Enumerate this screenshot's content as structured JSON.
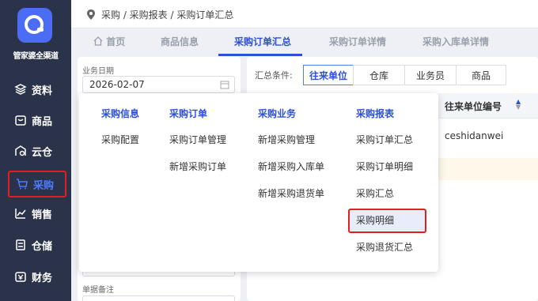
{
  "app": {
    "brand": "管家婆全渠道"
  },
  "sidebar": {
    "items": [
      {
        "label": "资料",
        "icon": "layers-icon",
        "active": false
      },
      {
        "label": "商品",
        "icon": "box-icon",
        "active": false
      },
      {
        "label": "云仓",
        "icon": "cloud-warehouse-icon",
        "active": false
      },
      {
        "label": "采购",
        "icon": "cart-icon",
        "active": true
      },
      {
        "label": "销售",
        "icon": "chart-icon",
        "active": false
      },
      {
        "label": "仓储",
        "icon": "storage-icon",
        "active": false
      },
      {
        "label": "财务",
        "icon": "finance-icon",
        "active": false
      }
    ]
  },
  "breadcrumb": "采购 / 采购报表 / 采购订单汇总",
  "tabs": [
    {
      "label": "首页",
      "icon": "home-icon",
      "active": false
    },
    {
      "label": "商品信息",
      "active": false
    },
    {
      "label": "采购订单汇总",
      "active": true
    },
    {
      "label": "采购订单详情",
      "active": false
    },
    {
      "label": "采购入库单详情",
      "active": false
    }
  ],
  "filters": {
    "business_date_label": "业务日期",
    "business_date_value": "2026-02-07",
    "remark_label": "单据备注"
  },
  "summary": {
    "label": "汇总条件:",
    "options": [
      "往来单位",
      "仓库",
      "业务员",
      "商品"
    ],
    "selected": "往来单位"
  },
  "table": {
    "header": "往来单位编号",
    "row_value": "ceshidanwei"
  },
  "mega_menu": {
    "columns": [
      {
        "title": "采购信息",
        "items": [
          "采购配置"
        ]
      },
      {
        "title": "采购订单",
        "items": [
          "采购订单管理",
          "新增采购订单"
        ]
      },
      {
        "title": "采购业务",
        "items": [
          "新增采购管理",
          "新增采购入库单",
          "新增采购退货单"
        ]
      },
      {
        "title": "采购报表",
        "items": [
          "采购订单汇总",
          "采购订单明细",
          "采购汇总",
          "采购明细",
          "采购退货汇总"
        ]
      }
    ],
    "highlighted_item": "采购明细"
  },
  "colors": {
    "accent": "#2d50d8",
    "sidebar_bg": "#2a3349",
    "highlight_border": "#e02020"
  }
}
